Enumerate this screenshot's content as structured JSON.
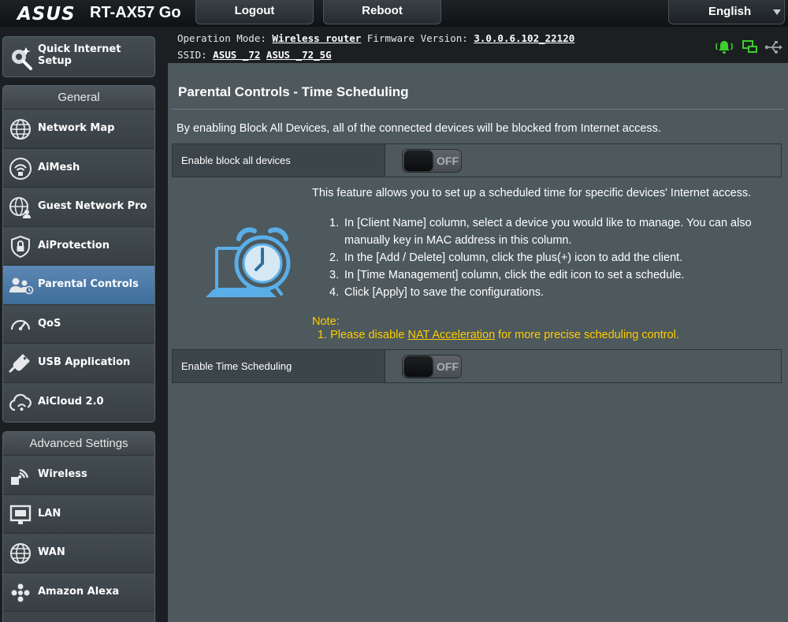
{
  "header": {
    "brand": "ASUS",
    "model": "RT-AX57 Go",
    "logout_label": "Logout",
    "reboot_label": "Reboot",
    "language": "English"
  },
  "status": {
    "operation_mode_label": "Operation Mode:",
    "operation_mode_value": "Wireless router",
    "firmware_label": "Firmware Version:",
    "firmware_value": "3.0.0.6.102_22120",
    "ssid_label": "SSID:",
    "ssid_1": "ASUS _72",
    "ssid_2": "ASUS _72_5G",
    "icons": [
      "notification-bell-icon",
      "network-status-icon",
      "usb-icon"
    ],
    "status_color": "#3bd12a"
  },
  "sidebar": {
    "quick_setup": "Quick Internet Setup",
    "general_title": "General",
    "general_items": [
      {
        "label": "Network Map",
        "icon": "network-map-icon"
      },
      {
        "label": "AiMesh",
        "icon": "aimesh-icon"
      },
      {
        "label": "Guest Network Pro",
        "icon": "guest-network-icon"
      },
      {
        "label": "AiProtection",
        "icon": "aiprotection-icon"
      },
      {
        "label": "Parental Controls",
        "icon": "parental-controls-icon",
        "active": true
      },
      {
        "label": "QoS",
        "icon": "qos-icon"
      },
      {
        "label": "USB Application",
        "icon": "usb-application-icon"
      },
      {
        "label": "AiCloud 2.0",
        "icon": "aicloud-icon"
      }
    ],
    "advanced_title": "Advanced Settings",
    "advanced_items": [
      {
        "label": "Wireless",
        "icon": "wireless-icon"
      },
      {
        "label": "LAN",
        "icon": "lan-icon"
      },
      {
        "label": "WAN",
        "icon": "wan-icon"
      },
      {
        "label": "Amazon Alexa",
        "icon": "alexa-icon"
      }
    ]
  },
  "main": {
    "title": "Parental Controls - Time Scheduling",
    "block_desc": "By enabling Block All Devices, all of the connected devices will be blocked from Internet access.",
    "block_all_label": "Enable block all devices",
    "block_all_state": "OFF",
    "intro": "This feature allows you to set up a scheduled time for specific devices' Internet access.",
    "steps": [
      {
        "num": "1.",
        "text": "In [Client Name] column, select a device you would like to manage. You can also manually key in MAC address in this column."
      },
      {
        "num": "2.",
        "text": "In the [Add / Delete] column, click the plus(+) icon to add the client."
      },
      {
        "num": "3.",
        "text": "In [Time Management] column, click the edit icon to set a schedule."
      },
      {
        "num": "4.",
        "text": "Click [Apply] to save the configurations."
      }
    ],
    "note_title": "Note:",
    "note_prefix": "1. Please disable ",
    "note_link": "NAT Acceleration",
    "note_suffix": " for more precise scheduling control.",
    "time_sched_label": "Enable Time Scheduling",
    "time_sched_state": "OFF",
    "illustration_icon": "alarm-clock-laptop-icon",
    "accent_color": "#ffcc00"
  }
}
